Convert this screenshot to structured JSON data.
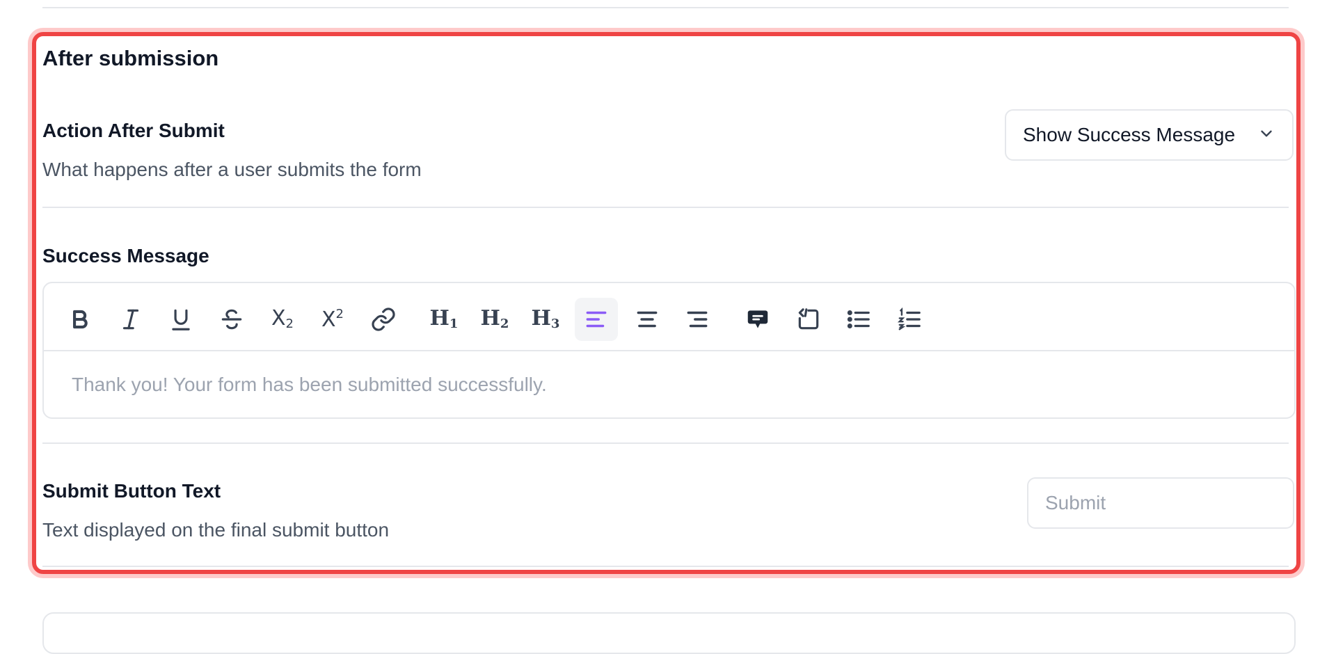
{
  "section": {
    "title": "After submission"
  },
  "action_after_submit": {
    "label": "Action After Submit",
    "description": "What happens after a user submits the form",
    "selected": "Show Success Message"
  },
  "success_message": {
    "label": "Success Message",
    "content": "Thank you! Your form has been submitted successfully.",
    "toolbar": {
      "h1": "H",
      "h1_sub": "1",
      "h2": "H",
      "h2_sub": "2",
      "h3": "H",
      "h3_sub": "3",
      "subscript": "X",
      "subscript_mark": "2",
      "superscript": "X",
      "superscript_mark": "2"
    }
  },
  "submit_button_text": {
    "label": "Submit Button Text",
    "description": "Text displayed on the final submit button",
    "placeholder": "Submit"
  },
  "colors": {
    "highlight_border": "#ef4444",
    "highlight_glow": "#fecaca",
    "active_toolbar": "#8b5cf6"
  }
}
